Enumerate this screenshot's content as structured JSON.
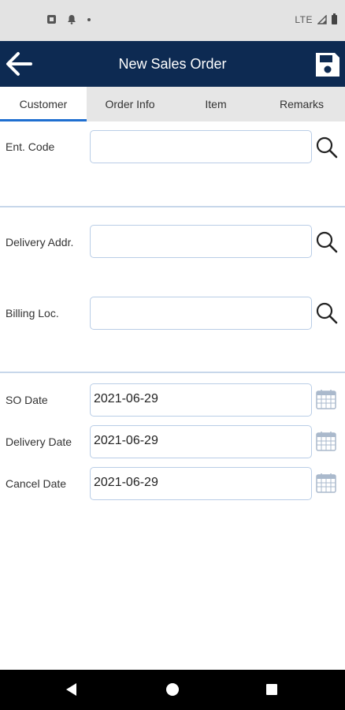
{
  "status_bar": {
    "network": "LTE"
  },
  "app_bar": {
    "title": "New Sales Order"
  },
  "tabs": [
    {
      "label": "Customer",
      "active": true
    },
    {
      "label": "Order Info",
      "active": false
    },
    {
      "label": "Item",
      "active": false
    },
    {
      "label": "Remarks",
      "active": false
    }
  ],
  "customer": {
    "ent_code_label": "Ent. Code",
    "ent_code_value": "",
    "delivery_addr_label": "Delivery Addr.",
    "delivery_addr_value": "",
    "billing_loc_label": "Billing Loc.",
    "billing_loc_value": ""
  },
  "dates": {
    "so_date_label": "SO Date",
    "so_date_value": "2021-06-29",
    "delivery_date_label": "Delivery Date",
    "delivery_date_value": "2021-06-29",
    "cancel_date_label": "Cancel Date",
    "cancel_date_value": "2021-06-29"
  },
  "colors": {
    "app_bar": "#0d2a52",
    "tab_indicator": "#1f6fd0",
    "field_border": "#b9cde6",
    "icons": [
      "arrow-left-icon",
      "save-icon",
      "search-icon",
      "calendar-icon"
    ]
  }
}
